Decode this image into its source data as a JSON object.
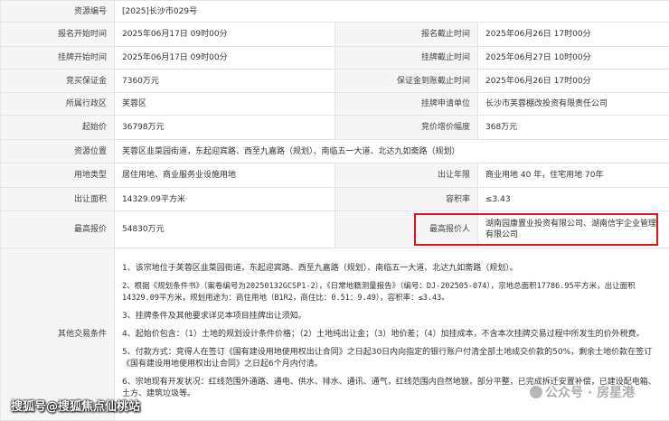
{
  "rows": {
    "resource_no": {
      "label": "资源编号",
      "value": "[2025]长沙市029号"
    },
    "signup_start": {
      "label": "报名开始时间",
      "value": "2025年06月17日 09时00分"
    },
    "signup_end": {
      "label": "报名截止时间",
      "value": "2025年06月26日 17时00分"
    },
    "listing_start": {
      "label": "挂牌开始时间",
      "value": "2025年06月17日 09时00分"
    },
    "listing_end": {
      "label": "挂牌截止时间",
      "value": "2025年06月27日 10时00分"
    },
    "deposit": {
      "label": "竞买保证金",
      "value": "7360万元"
    },
    "deposit_deadline": {
      "label": "保证金到账截止时间",
      "value": "2025年06月26日 17时00分"
    },
    "district": {
      "label": "所属行政区",
      "value": "芙蓉区"
    },
    "applicant_unit": {
      "label": "挂牌申请单位",
      "value": "长沙市芙蓉棚改投资有限责任公司"
    },
    "start_price": {
      "label": "起始价",
      "value": "36798万元"
    },
    "bid_increment": {
      "label": "竞价增价幅度",
      "value": "368万元"
    },
    "location": {
      "label": "资源位置",
      "value": "芙蓉区韭菜园街道，东起迎宾路、西至九嘉路（规划）、南临五一大道、北达九如斋路（规划）"
    },
    "land_use": {
      "label": "用地类型",
      "value": "居住用地、商业服务业设施用地"
    },
    "lease_term": {
      "label": "出让年限",
      "value": "商业用地 40 年，住宅用地 70年"
    },
    "area": {
      "label": "出让面积",
      "value": "14329.09平方米"
    },
    "plot_ratio": {
      "label": "容积率",
      "value": "≤3.43"
    },
    "top_bid": {
      "label": "最高报价",
      "value": "54830万元"
    },
    "top_bidder": {
      "label": "最高报价人",
      "value": "湖南园康置业投资有限公司、湖南信宇企业管理有限公司"
    }
  },
  "other_conditions": {
    "label": "其他交易条件",
    "items": [
      "1、该宗地位于芙蓉区韭菜园街道，东起迎宾路、西至九嘉路（规划）、南临五一大道、北达九如斋路（规划）。",
      "2、根据《规划条件书》（案卷编号为20250132GCSP1-2），《日常地籍测量报告》（编号：DJ-202505-074），宗地总面积17786.95平方米，出让面积14329.09平方米，规划用途为：商住用地（B1R2，商住比：0.51：9.49），容积率：≤3.43。",
      "3、挂牌条件及其他要求详见本项目挂牌出让须知。",
      "4、起始价包含：（1）土地的规划设计条件价格；（2）土地纯出让金；（3）地价差；（4）加挂成本，不含本次挂牌交易过程中所发生的价外税费。",
      "5、付款方式：竞得人在签订《国有建设用地使用权出让合同》之日起30日内向指定的银行账户付清全部土地成交价款的50%，剩余土地价款在签订《国有建设用地使用权出让合同》之日起6个月内付清。",
      "6、宗地现有开发状况：红线范围外通路、通电、供水、排水、通讯、通气，红线范围内自然地貌，部分平整，已完成拆迁安置补偿，已建设配电箱、土方、建筑垃圾等。"
    ]
  },
  "watermarks": {
    "left": "搜狐号@搜狐焦点仙桃站",
    "right": "公众号 · 房星港"
  },
  "colors": {
    "label_bg": "#f5f5f5",
    "border": "#e4e4e4",
    "highlight": "#e0141e"
  }
}
